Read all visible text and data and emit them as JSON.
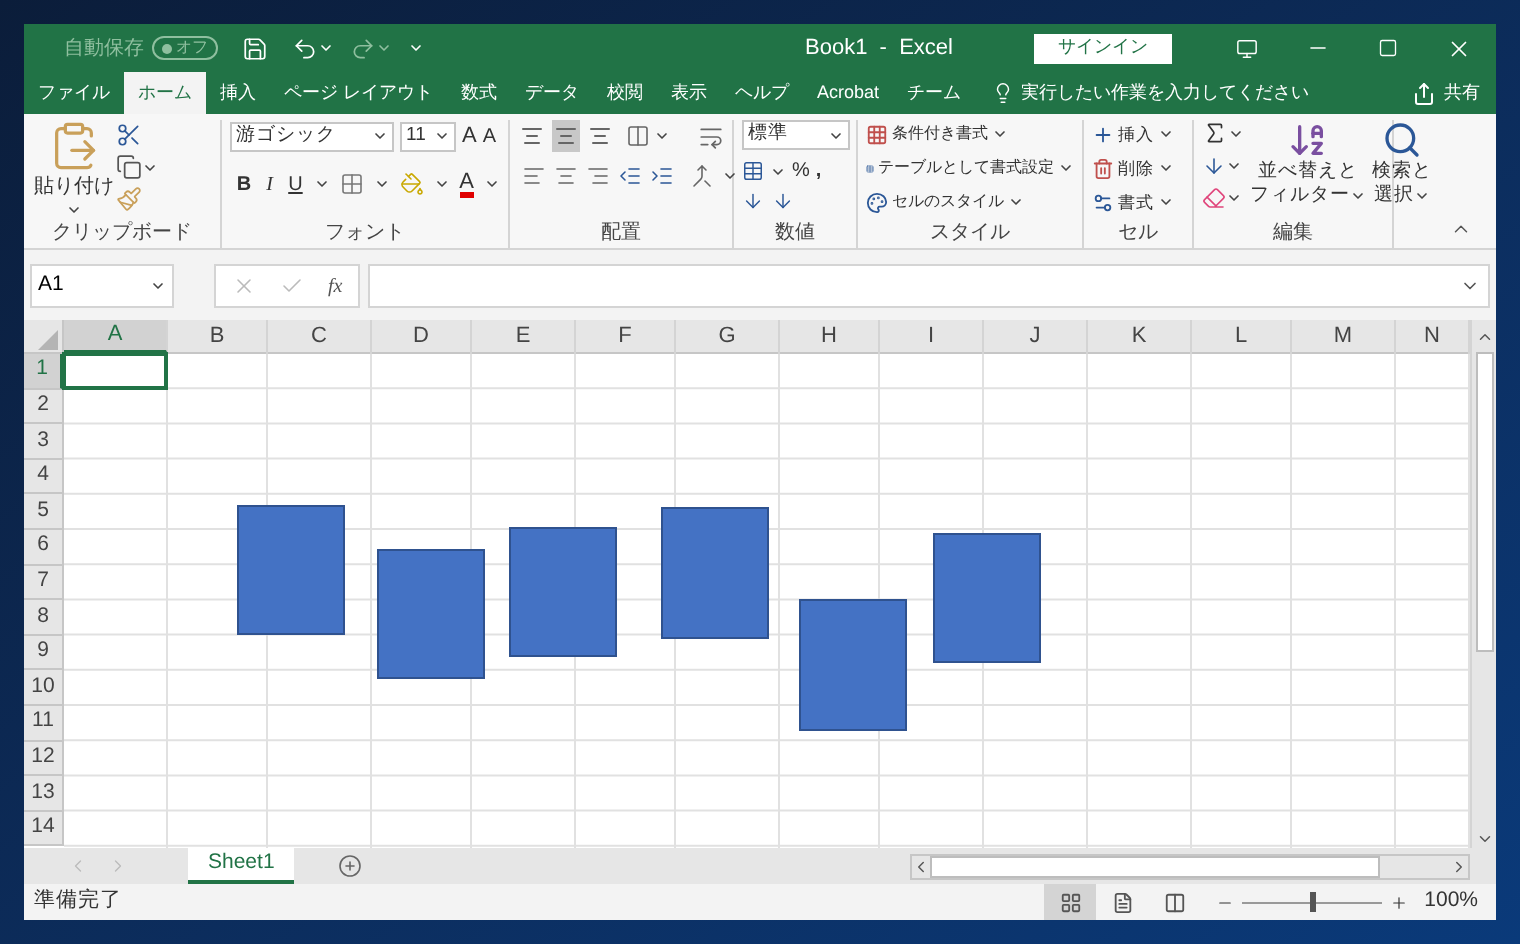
{
  "titlebar": {
    "autosave": {
      "label": "自動保存",
      "on": false,
      "state_text": "オフ"
    },
    "title": "Book1  -  Excel",
    "signin": "サインイン"
  },
  "tabs": [
    {
      "label": "ファイル",
      "selected": false
    },
    {
      "label": "ホーム",
      "selected": true
    },
    {
      "label": "挿入",
      "selected": false
    },
    {
      "label": "ページ レイアウト",
      "selected": false
    },
    {
      "label": "数式",
      "selected": false
    },
    {
      "label": "データ",
      "selected": false
    },
    {
      "label": "校閲",
      "selected": false
    },
    {
      "label": "表示",
      "selected": false
    },
    {
      "label": "ヘルプ",
      "selected": false
    },
    {
      "label": "Acrobat",
      "selected": false
    },
    {
      "label": "チーム",
      "selected": false
    }
  ],
  "tell_me": {
    "placeholder": "実行したい作業を入力してください"
  },
  "share": "共有",
  "ribbon": {
    "clipboard": {
      "paste": "貼り付け",
      "label": "クリップボード"
    },
    "font": {
      "name": "游ゴシック",
      "size": "11",
      "grow": "A",
      "shrink": "A",
      "bold": "B",
      "italic": "I",
      "underline": "U",
      "text_color_label": "A",
      "label": "フォント"
    },
    "alignment": {
      "vertical": [
        {
          "selected": false
        },
        {
          "selected": true
        },
        {
          "selected": false
        }
      ],
      "label": "配置"
    },
    "number": {
      "format": "標準",
      "percent": "%",
      "comma": ",",
      "label": "数値"
    },
    "styles": {
      "items": [
        "条件付き書式",
        "テーブルとして書式設定",
        "セルのスタイル"
      ],
      "label": "スタイル"
    },
    "cells": {
      "items": [
        "挿入",
        "削除",
        "書式"
      ],
      "label": "セル"
    },
    "editing": {
      "sort": [
        "並べ替えと",
        "フィルター"
      ],
      "find": [
        "検索と",
        "選択"
      ],
      "label": "編集"
    }
  },
  "formula_bar": {
    "name_box": "A1",
    "fx": "fx"
  },
  "grid": {
    "columns": [
      {
        "label": "A",
        "selected": true
      },
      {
        "label": "B",
        "selected": false
      },
      {
        "label": "C",
        "selected": false
      },
      {
        "label": "D",
        "selected": false
      },
      {
        "label": "E",
        "selected": false
      },
      {
        "label": "F",
        "selected": false
      },
      {
        "label": "G",
        "selected": false
      },
      {
        "label": "H",
        "selected": false
      },
      {
        "label": "I",
        "selected": false
      },
      {
        "label": "J",
        "selected": false
      },
      {
        "label": "K",
        "selected": false
      },
      {
        "label": "L",
        "selected": false
      },
      {
        "label": "M",
        "selected": false
      },
      {
        "label": "N",
        "selected": false
      }
    ],
    "rows": [
      {
        "label": "1",
        "selected": true
      },
      {
        "label": "2",
        "selected": false
      },
      {
        "label": "3",
        "selected": false
      },
      {
        "label": "4",
        "selected": false
      },
      {
        "label": "5",
        "selected": false
      },
      {
        "label": "6",
        "selected": false
      },
      {
        "label": "7",
        "selected": false
      },
      {
        "label": "8",
        "selected": false
      },
      {
        "label": "9",
        "selected": false
      },
      {
        "label": "10",
        "selected": false
      },
      {
        "label": "11",
        "selected": false
      },
      {
        "label": "12",
        "selected": false
      },
      {
        "label": "13",
        "selected": false
      },
      {
        "label": "14",
        "selected": false
      }
    ]
  },
  "shapes": [
    {
      "kind": "rectangle"
    },
    {
      "kind": "rectangle"
    },
    {
      "kind": "rectangle"
    },
    {
      "kind": "rectangle"
    },
    {
      "kind": "rectangle"
    },
    {
      "kind": "rectangle"
    }
  ],
  "sheets": [
    {
      "label": "Sheet1",
      "selected": true
    }
  ],
  "status": {
    "text": "準備完了",
    "views": [
      {
        "selected": true
      },
      {
        "selected": false
      },
      {
        "selected": false
      }
    ],
    "zoom": {
      "level": 0.5,
      "reading": "100%"
    }
  }
}
